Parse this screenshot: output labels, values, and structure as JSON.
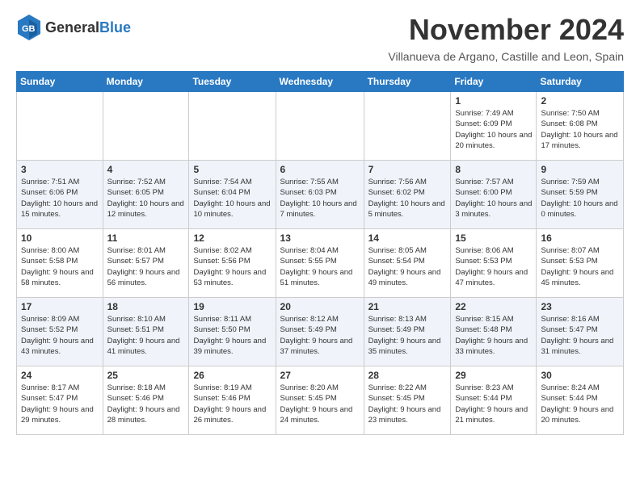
{
  "logo": {
    "general": "General",
    "blue": "Blue"
  },
  "title": "November 2024",
  "subtitle": "Villanueva de Argano, Castille and Leon, Spain",
  "days_of_week": [
    "Sunday",
    "Monday",
    "Tuesday",
    "Wednesday",
    "Thursday",
    "Friday",
    "Saturday"
  ],
  "weeks": [
    [
      {
        "day": "",
        "info": ""
      },
      {
        "day": "",
        "info": ""
      },
      {
        "day": "",
        "info": ""
      },
      {
        "day": "",
        "info": ""
      },
      {
        "day": "",
        "info": ""
      },
      {
        "day": "1",
        "info": "Sunrise: 7:49 AM\nSunset: 6:09 PM\nDaylight: 10 hours and 20 minutes."
      },
      {
        "day": "2",
        "info": "Sunrise: 7:50 AM\nSunset: 6:08 PM\nDaylight: 10 hours and 17 minutes."
      }
    ],
    [
      {
        "day": "3",
        "info": "Sunrise: 7:51 AM\nSunset: 6:06 PM\nDaylight: 10 hours and 15 minutes."
      },
      {
        "day": "4",
        "info": "Sunrise: 7:52 AM\nSunset: 6:05 PM\nDaylight: 10 hours and 12 minutes."
      },
      {
        "day": "5",
        "info": "Sunrise: 7:54 AM\nSunset: 6:04 PM\nDaylight: 10 hours and 10 minutes."
      },
      {
        "day": "6",
        "info": "Sunrise: 7:55 AM\nSunset: 6:03 PM\nDaylight: 10 hours and 7 minutes."
      },
      {
        "day": "7",
        "info": "Sunrise: 7:56 AM\nSunset: 6:02 PM\nDaylight: 10 hours and 5 minutes."
      },
      {
        "day": "8",
        "info": "Sunrise: 7:57 AM\nSunset: 6:00 PM\nDaylight: 10 hours and 3 minutes."
      },
      {
        "day": "9",
        "info": "Sunrise: 7:59 AM\nSunset: 5:59 PM\nDaylight: 10 hours and 0 minutes."
      }
    ],
    [
      {
        "day": "10",
        "info": "Sunrise: 8:00 AM\nSunset: 5:58 PM\nDaylight: 9 hours and 58 minutes."
      },
      {
        "day": "11",
        "info": "Sunrise: 8:01 AM\nSunset: 5:57 PM\nDaylight: 9 hours and 56 minutes."
      },
      {
        "day": "12",
        "info": "Sunrise: 8:02 AM\nSunset: 5:56 PM\nDaylight: 9 hours and 53 minutes."
      },
      {
        "day": "13",
        "info": "Sunrise: 8:04 AM\nSunset: 5:55 PM\nDaylight: 9 hours and 51 minutes."
      },
      {
        "day": "14",
        "info": "Sunrise: 8:05 AM\nSunset: 5:54 PM\nDaylight: 9 hours and 49 minutes."
      },
      {
        "day": "15",
        "info": "Sunrise: 8:06 AM\nSunset: 5:53 PM\nDaylight: 9 hours and 47 minutes."
      },
      {
        "day": "16",
        "info": "Sunrise: 8:07 AM\nSunset: 5:53 PM\nDaylight: 9 hours and 45 minutes."
      }
    ],
    [
      {
        "day": "17",
        "info": "Sunrise: 8:09 AM\nSunset: 5:52 PM\nDaylight: 9 hours and 43 minutes."
      },
      {
        "day": "18",
        "info": "Sunrise: 8:10 AM\nSunset: 5:51 PM\nDaylight: 9 hours and 41 minutes."
      },
      {
        "day": "19",
        "info": "Sunrise: 8:11 AM\nSunset: 5:50 PM\nDaylight: 9 hours and 39 minutes."
      },
      {
        "day": "20",
        "info": "Sunrise: 8:12 AM\nSunset: 5:49 PM\nDaylight: 9 hours and 37 minutes."
      },
      {
        "day": "21",
        "info": "Sunrise: 8:13 AM\nSunset: 5:49 PM\nDaylight: 9 hours and 35 minutes."
      },
      {
        "day": "22",
        "info": "Sunrise: 8:15 AM\nSunset: 5:48 PM\nDaylight: 9 hours and 33 minutes."
      },
      {
        "day": "23",
        "info": "Sunrise: 8:16 AM\nSunset: 5:47 PM\nDaylight: 9 hours and 31 minutes."
      }
    ],
    [
      {
        "day": "24",
        "info": "Sunrise: 8:17 AM\nSunset: 5:47 PM\nDaylight: 9 hours and 29 minutes."
      },
      {
        "day": "25",
        "info": "Sunrise: 8:18 AM\nSunset: 5:46 PM\nDaylight: 9 hours and 28 minutes."
      },
      {
        "day": "26",
        "info": "Sunrise: 8:19 AM\nSunset: 5:46 PM\nDaylight: 9 hours and 26 minutes."
      },
      {
        "day": "27",
        "info": "Sunrise: 8:20 AM\nSunset: 5:45 PM\nDaylight: 9 hours and 24 minutes."
      },
      {
        "day": "28",
        "info": "Sunrise: 8:22 AM\nSunset: 5:45 PM\nDaylight: 9 hours and 23 minutes."
      },
      {
        "day": "29",
        "info": "Sunrise: 8:23 AM\nSunset: 5:44 PM\nDaylight: 9 hours and 21 minutes."
      },
      {
        "day": "30",
        "info": "Sunrise: 8:24 AM\nSunset: 5:44 PM\nDaylight: 9 hours and 20 minutes."
      }
    ]
  ]
}
